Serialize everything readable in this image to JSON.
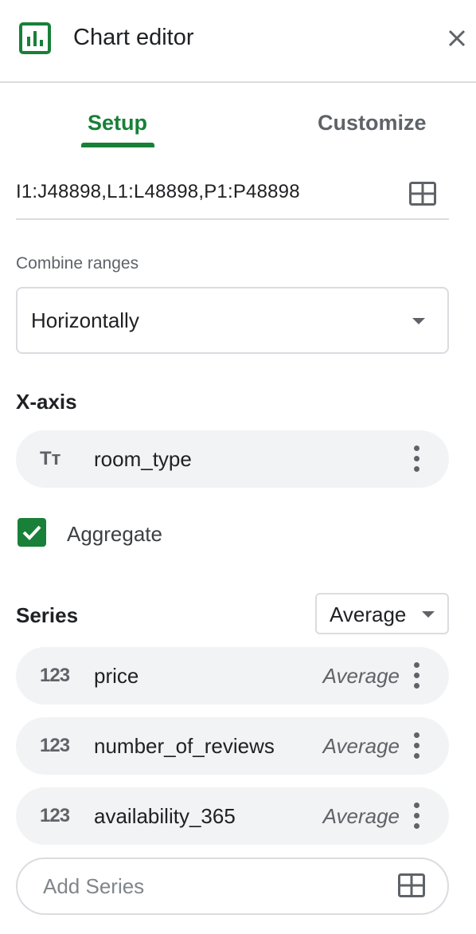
{
  "header": {
    "title": "Chart editor",
    "app_icon": "bar-chart-icon",
    "close_icon": "close-icon"
  },
  "tabs": [
    {
      "label": "Setup",
      "active": true
    },
    {
      "label": "Customize",
      "active": false
    }
  ],
  "data_range": {
    "value": "I1:J48898,L1:L48898,P1:P48898",
    "icon": "grid-select-icon"
  },
  "combine_ranges": {
    "label": "Combine ranges",
    "value": "Horizontally"
  },
  "x_axis": {
    "heading": "X-axis",
    "field": {
      "type_icon": "Tт",
      "name": "room_type"
    }
  },
  "aggregate": {
    "label": "Aggregate",
    "checked": true
  },
  "series": {
    "heading": "Series",
    "aggregation_dropdown": "Average",
    "items": [
      {
        "type_icon": "123",
        "name": "price",
        "aggregation": "Average"
      },
      {
        "type_icon": "123",
        "name": "number_of_reviews",
        "aggregation": "Average"
      },
      {
        "type_icon": "123",
        "name": "availability_365",
        "aggregation": "Average"
      }
    ],
    "add_placeholder": "Add Series"
  },
  "colors": {
    "accent": "#188038",
    "chip_bg": "#f1f3f4",
    "border": "#dadce0",
    "muted": "#5f6368"
  }
}
